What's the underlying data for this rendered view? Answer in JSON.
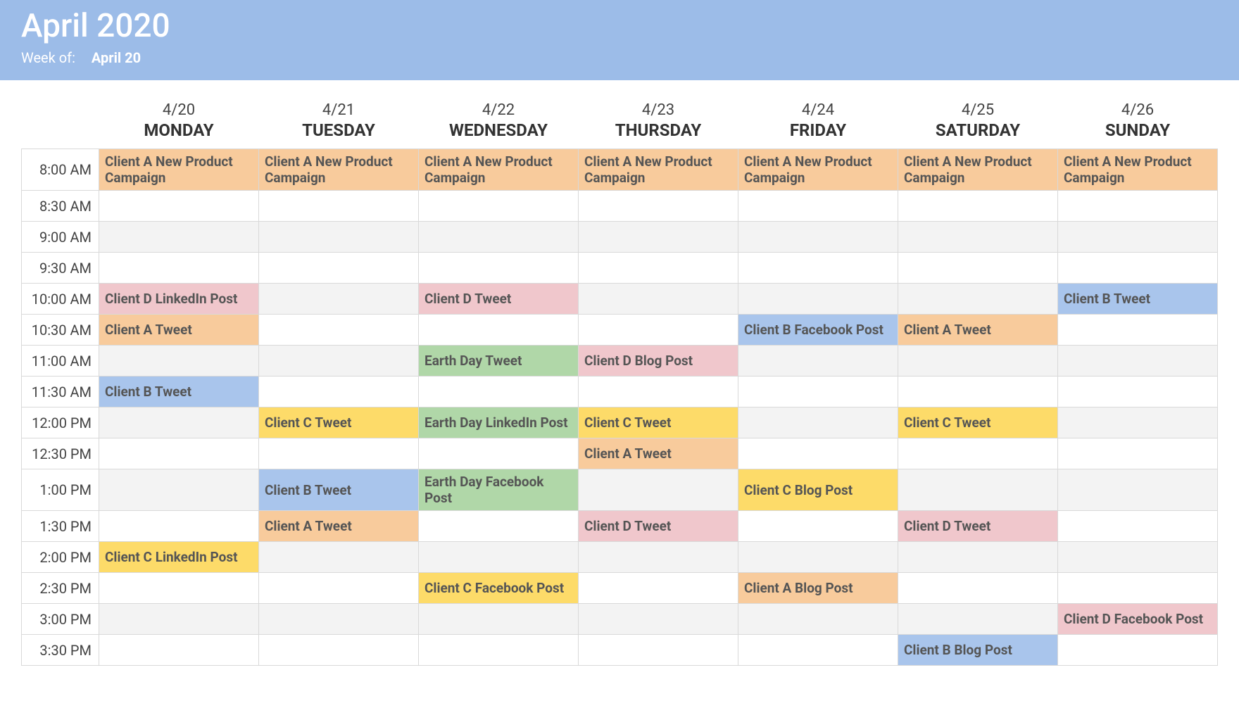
{
  "header": {
    "title": "April 2020",
    "weekof_label": "Week of:",
    "weekof_value": "April 20"
  },
  "days": [
    {
      "date": "4/20",
      "name": "MONDAY"
    },
    {
      "date": "4/21",
      "name": "TUESDAY"
    },
    {
      "date": "4/22",
      "name": "WEDNESDAY"
    },
    {
      "date": "4/23",
      "name": "THURSDAY"
    },
    {
      "date": "4/24",
      "name": "FRIDAY"
    },
    {
      "date": "4/25",
      "name": "SATURDAY"
    },
    {
      "date": "4/26",
      "name": "SUNDAY"
    }
  ],
  "times": [
    "8:00 AM",
    "8:30 AM",
    "9:00 AM",
    "9:30 AM",
    "10:00 AM",
    "10:30 AM",
    "11:00 AM",
    "11:30 AM",
    "12:00 PM",
    "12:30 PM",
    "1:00 PM",
    "1:30 PM",
    "2:00 PM",
    "2:30 PM",
    "3:00 PM",
    "3:30 PM"
  ],
  "colors": {
    "orange": "#f8cb9c",
    "pink": "#f0c7cc",
    "blue": "#a9c5ec",
    "green": "#b0d7a8",
    "yellow": "#fddb69"
  },
  "events": {
    "r0_c0": "Client A New Product Campaign",
    "r0_c1": "Client A New Product Campaign",
    "r0_c2": "Client A New Product Campaign",
    "r0_c3": "Client A New Product Campaign",
    "r0_c4": "Client A New Product Campaign",
    "r0_c5": "Client A New Product Campaign",
    "r0_c6": "Client A New Product Campaign",
    "r4_c0": "Client D LinkedIn Post",
    "r4_c2": "Client D Tweet",
    "r4_c6": "Client B Tweet",
    "r5_c0": "Client A Tweet",
    "r5_c4": "Client B Facebook Post",
    "r5_c5": "Client A Tweet",
    "r6_c2": "Earth Day Tweet",
    "r6_c3": "Client D Blog Post",
    "r7_c0": "Client B Tweet",
    "r8_c1": "Client C Tweet",
    "r8_c2": "Earth Day LinkedIn Post",
    "r8_c3": "Client C Tweet",
    "r8_c5": "Client C Tweet",
    "r9_c3": "Client A Tweet",
    "r10_c1": "Client B Tweet",
    "r10_c2": "Earth Day Facebook Post",
    "r10_c4": "Client C Blog Post",
    "r11_c1": "Client A Tweet",
    "r11_c3": "Client D Tweet",
    "r11_c5": "Client D Tweet",
    "r12_c0": "Client C LinkedIn Post",
    "r13_c2": "Client C Facebook Post",
    "r13_c4": "Client A Blog Post",
    "r14_c6": "Client D Facebook Post",
    "r15_c5": "Client B Blog Post"
  }
}
